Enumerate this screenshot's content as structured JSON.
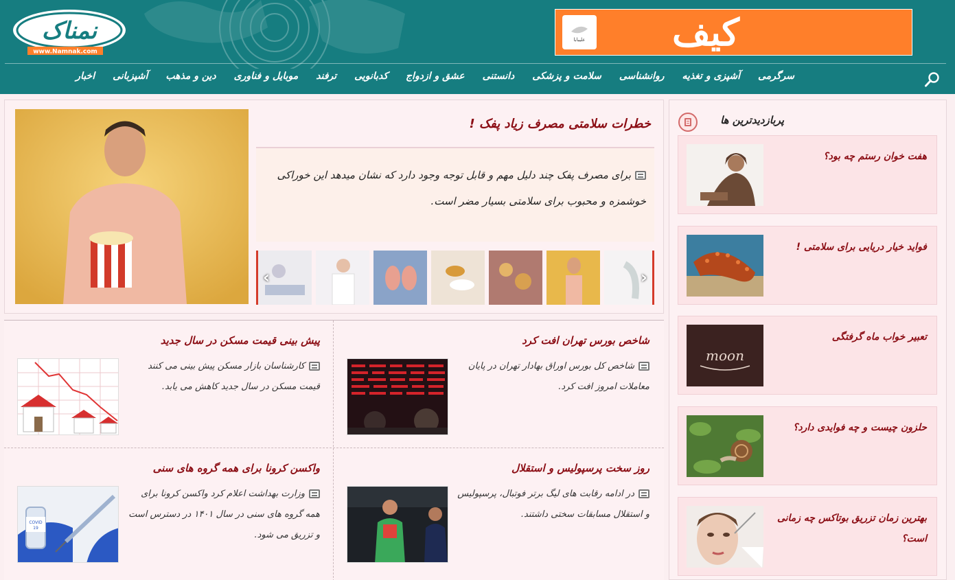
{
  "header": {
    "logo_text": "نمناک",
    "logo_url": "www.Namnak.com",
    "ad_logo_caption": "علیبابا",
    "ad_text": "کیف"
  },
  "nav": {
    "items": [
      "سرگرمی",
      "آشپزی و تغذیه",
      "روانشناسی",
      "سلامت و پزشکی",
      "دانستنی",
      "عشق و ازدواج",
      "کدبانویی",
      "ترفند",
      "موبایل و فناوری",
      "دین و مذهب",
      "آشپزبانی",
      "اخبار"
    ]
  },
  "hero": {
    "title": "خطرات سلامتی مصرف زیاد پفک !",
    "summary": "برای مصرف پفک چند دلیل مهم و قابل توجه وجود دارد که نشان میدهد این خوراکی خوشمزه و محبوب برای سلامتی بسیار مضر است."
  },
  "articles": [
    {
      "title": "شاخص بورس تهران افت کرد",
      "summary": "شاخص کل بورس اوراق بهادار تهران در پایان معاملات امروز افت کرد."
    },
    {
      "title": "پیش بینی قیمت مسکن در سال جدید",
      "summary": "کارشناسان بازار مسکن پیش بینی می کنند قیمت مسکن در سال جدید کاهش می یابد."
    },
    {
      "title": "روز سخت پرسپولیس و استقلال",
      "summary": "در ادامه رقابت های لیگ برتر فوتبال، پرسپولیس و استقلال مسابقات سختی داشتند."
    },
    {
      "title": "واکسن کرونا برای همه گروه های سنی",
      "summary": "وزارت بهداشت اعلام کرد واکسن کرونا برای همه گروه های سنی در سال ۱۴۰۱ در دسترس است و تزریق می شود."
    }
  ],
  "sidebar": {
    "heading": "پربازدیدترین ها",
    "items": [
      "هفت خوان رستم چه بود؟",
      "فواید خیار دریایی برای سلامتی !",
      "تعبیر خواب ماه گرفتگی",
      "حلزون چیست و چه فوایدی دارد؟",
      "بهترین زمان تزریق بوتاکس چه زمانی است؟"
    ]
  },
  "colors": {
    "header_bg": "#167d80",
    "accent_red": "#8b0d14",
    "ad_orange": "#ff7f2a",
    "page_bg": "#fbeff1"
  },
  "icons": {
    "search": "search-icon",
    "article": "document-icon",
    "slider_prev": "chevron-left-icon",
    "slider_next": "chevron-right-icon",
    "sidebar_heading": "list-icon"
  }
}
